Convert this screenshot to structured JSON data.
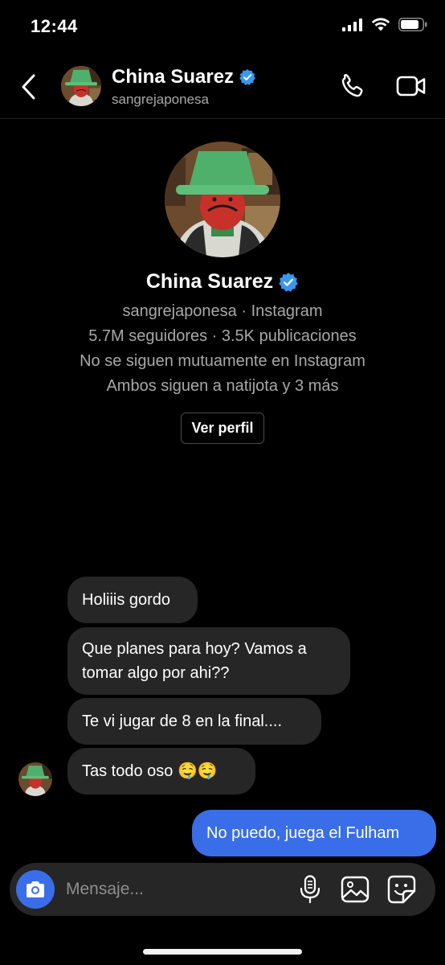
{
  "status_bar": {
    "time": "12:44",
    "battery_level": 0.8
  },
  "header": {
    "name": "China Suarez",
    "username": "sangrejaponesa",
    "verified": true
  },
  "profile": {
    "name": "China Suarez",
    "source_line": "sangrejaponesa · Instagram",
    "stats_line": "5.7M seguidores · 3.5K publicaciones",
    "follow_status": "No se siguen mutuamente en Instagram",
    "mutual_line": "Ambos siguen a natijota y 3 más",
    "view_profile_label": "Ver perfil"
  },
  "messages": [
    {
      "direction": "incoming",
      "text": "Holiiis gordo"
    },
    {
      "direction": "incoming",
      "text": "Que planes para hoy? Vamos a tomar algo por ahi??"
    },
    {
      "direction": "incoming",
      "text": "Te vi jugar de 8 en la final...."
    },
    {
      "direction": "incoming",
      "text": "Tas todo oso 🤤🤤"
    },
    {
      "direction": "outgoing",
      "text": "No puedo, juega el Fulham"
    }
  ],
  "composer": {
    "placeholder": "Mensaje...",
    "value": ""
  },
  "icons": {
    "back": "chevron-left-icon",
    "call": "phone-icon",
    "video": "video-camera-icon",
    "verified": "verified-badge-icon",
    "camera": "camera-icon",
    "mic": "microphone-icon",
    "gallery": "image-icon",
    "sticker": "sticker-icon"
  },
  "colors": {
    "background": "#000000",
    "bubble_incoming": "#262626",
    "bubble_outgoing": "#3a6ee8",
    "verified": "#3897f0",
    "secondary_text": "#a8a8a8"
  }
}
